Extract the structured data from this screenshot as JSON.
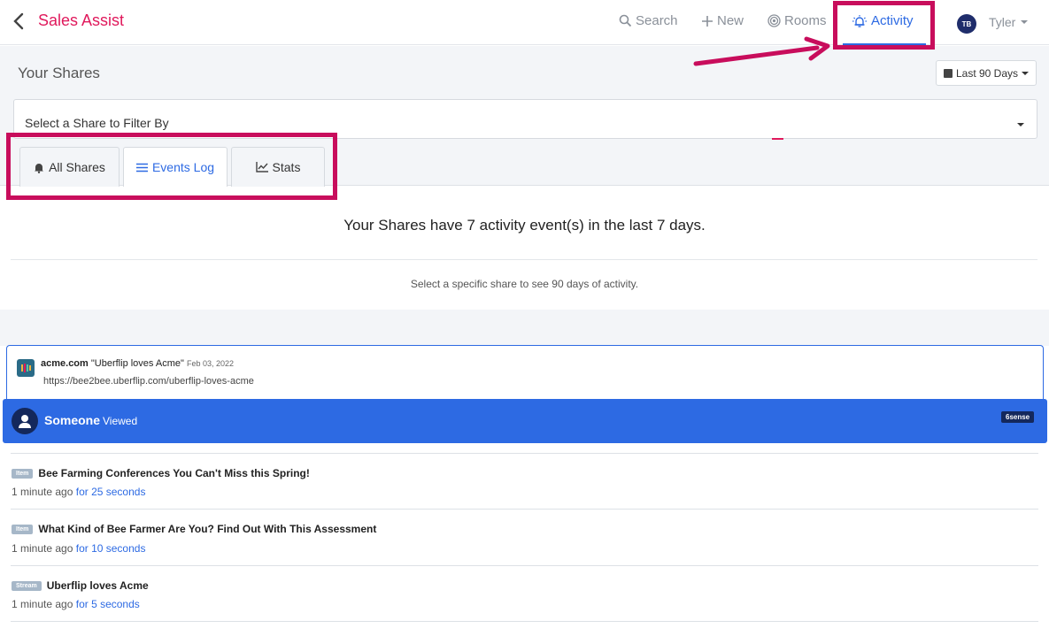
{
  "nav": {
    "brand": "Sales Assist",
    "search": "Search",
    "new": "New",
    "rooms": "Rooms",
    "activity": "Activity",
    "avatar_initials": "TB",
    "user": "Tyler"
  },
  "page": {
    "section_title": "Your Shares",
    "date_range": "Last 90 Days",
    "filter_placeholder": "Select a Share to Filter By",
    "tabs": [
      {
        "label": "All Shares",
        "icon": "bell-icon",
        "active": false
      },
      {
        "label": "Events Log",
        "icon": "list-icon",
        "active": true
      },
      {
        "label": "Stats",
        "icon": "chart-line-icon",
        "active": false
      }
    ],
    "summary": "Your Shares have 7 activity event(s) in the last 7 days.",
    "hint": "Select a specific share to see 90 days of activity."
  },
  "share": {
    "domain": "acme.com",
    "title": "\"Uberflip loves Acme\"",
    "date": "Feb 03, 2022",
    "url": "https://bee2bee.uberflip.com/uberflip-loves-acme",
    "viewer": "Someone",
    "action": "Viewed",
    "source_badge": "6sense"
  },
  "events": [
    {
      "type": "Item",
      "title": "Bee Farming Conferences You Can't Miss this Spring!",
      "when": "1 minute ago",
      "duration": "for 25 seconds"
    },
    {
      "type": "Item",
      "title": "What Kind of Bee Farmer Are You? Find Out With This Assessment",
      "when": "1 minute ago",
      "duration": "for 10 seconds"
    },
    {
      "type": "Stream",
      "title": "Uberflip loves Acme",
      "when": "1 minute ago",
      "duration": "for 5 seconds"
    }
  ],
  "colors": {
    "brand": "#e0195c",
    "accent": "#2d6ae3",
    "annotation": "#c80d5c",
    "badge": "#a6b7c8"
  }
}
